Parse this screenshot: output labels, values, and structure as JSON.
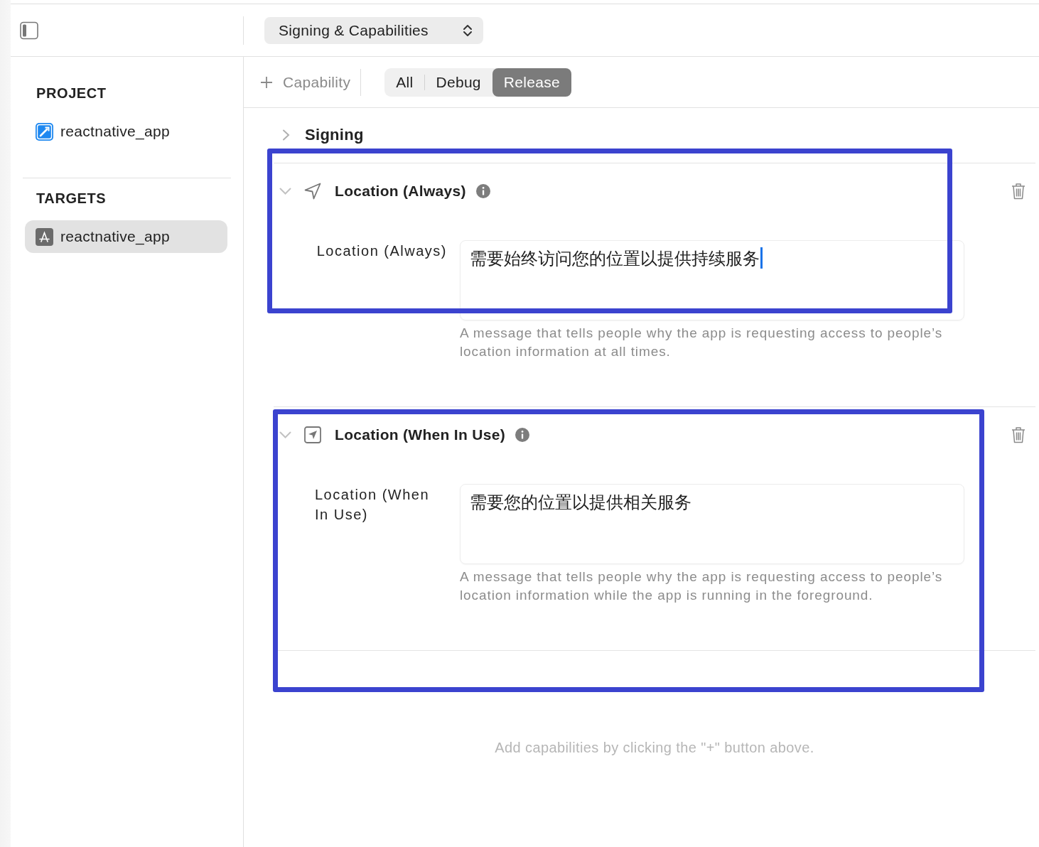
{
  "header": {
    "editor_picker": "Signing & Capabilities"
  },
  "sidebar": {
    "groups": [
      {
        "heading": "PROJECT",
        "items": [
          {
            "label": "reactnative_app",
            "kind": "project",
            "selected": false
          }
        ]
      },
      {
        "heading": "TARGETS",
        "items": [
          {
            "label": "reactnative_app",
            "kind": "target",
            "selected": true
          }
        ]
      }
    ]
  },
  "toolbar": {
    "add_button": "Capability",
    "configurations": [
      {
        "label": "All",
        "selected": false
      },
      {
        "label": "Debug",
        "selected": false
      },
      {
        "label": "Release",
        "selected": true
      }
    ]
  },
  "signing": {
    "title": "Signing",
    "expanded": false
  },
  "capabilities": [
    {
      "title": "Location (Always)",
      "expanded": true,
      "highlighted": true,
      "field_label": "Location (Always)",
      "value": "需要始终访问您的位置以提供持续服务",
      "focused": true,
      "description": "A message that tells people why the app is requesting access to people’s location information at all times."
    },
    {
      "title": "Location (When In Use)",
      "expanded": true,
      "highlighted": true,
      "field_label": "Location (When In Use)",
      "value": "需要您的位置以提供相关服务",
      "focused": false,
      "description": "A message that tells people why the app is requesting access to people’s location information while the app is running in the foreground."
    }
  ],
  "empty_hint": "Add capabilities by clicking the \"+\" button above."
}
